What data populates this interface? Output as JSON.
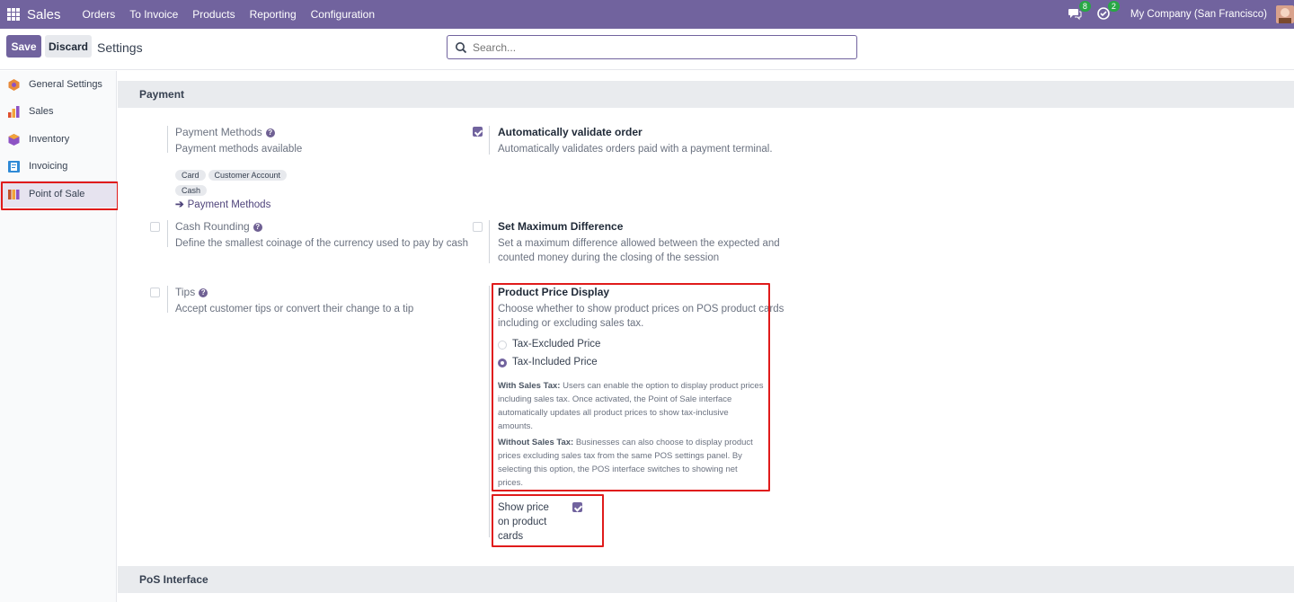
{
  "topbar": {
    "app_name": "Sales",
    "menu": [
      "Orders",
      "To Invoice",
      "Products",
      "Reporting",
      "Configuration"
    ],
    "messages_count": "8",
    "activities_count": "2",
    "company": "My Company (San Francisco)"
  },
  "control_panel": {
    "save_label": "Save",
    "discard_label": "Discard",
    "breadcrumb": "Settings",
    "search_placeholder": "Search..."
  },
  "sidebar": {
    "items": [
      {
        "label": "General Settings",
        "icon": "general-settings-icon",
        "color": "#e88a3a"
      },
      {
        "label": "Sales",
        "icon": "sales-icon",
        "color": "#e0502f"
      },
      {
        "label": "Inventory",
        "icon": "inventory-icon",
        "color": "#8d53c4"
      },
      {
        "label": "Invoicing",
        "icon": "invoicing-icon",
        "color": "#2f8ad6"
      },
      {
        "label": "Point of Sale",
        "icon": "pos-icon",
        "color": "#c0532d"
      }
    ],
    "active_index": 4
  },
  "payment_section": {
    "heading": "Payment",
    "payment_methods": {
      "title": "Payment Methods",
      "desc": "Payment methods available",
      "tags": [
        "Card",
        "Customer Account",
        "Cash"
      ],
      "link": "Payment Methods"
    },
    "auto_validate": {
      "title": "Automatically validate order",
      "desc": "Automatically validates orders paid with a payment terminal.",
      "checked": true
    },
    "cash_rounding": {
      "title": "Cash Rounding",
      "desc": "Define the smallest coinage of the currency used to pay by cash",
      "checked": false
    },
    "max_difference": {
      "title": "Set Maximum Difference",
      "desc_line1": "Set a maximum difference allowed between the expected and",
      "desc_line2": "counted money during the closing of the session",
      "checked": false
    },
    "tips": {
      "title": "Tips",
      "desc": "Accept customer tips or convert their change to a tip",
      "checked": false
    },
    "price_display": {
      "title": "Product Price Display",
      "desc_line1": "Choose whether to show product prices on POS product cards",
      "desc_line2": "including or excluding sales tax.",
      "options": [
        "Tax-Excluded Price",
        "Tax-Included Price"
      ],
      "selected_index": 1,
      "note1_label": "With Sales Tax:",
      "note1_l1": "Users can enable the option to display product prices",
      "note1_l2": "including sales tax. Once activated, the Point of Sale interface",
      "note1_l3": "automatically updates all product prices to show tax-inclusive",
      "note1_l4": "amounts.",
      "note2_label": "Without Sales Tax:",
      "note2_l1": "Businesses can also choose to display product",
      "note2_l2": "prices excluding sales tax from the same POS settings panel. By",
      "note2_l3": "selecting this option, the POS interface switches to showing net",
      "note2_l4": "prices."
    },
    "show_price": {
      "line1": "Show price",
      "line2": "on product",
      "line3": "cards",
      "checked": true
    }
  },
  "pos_interface_section": {
    "heading": "PoS Interface"
  },
  "colors": {
    "brand": "#71639e",
    "highlight": "#e01b1b",
    "section_bg": "#e9ebee"
  }
}
